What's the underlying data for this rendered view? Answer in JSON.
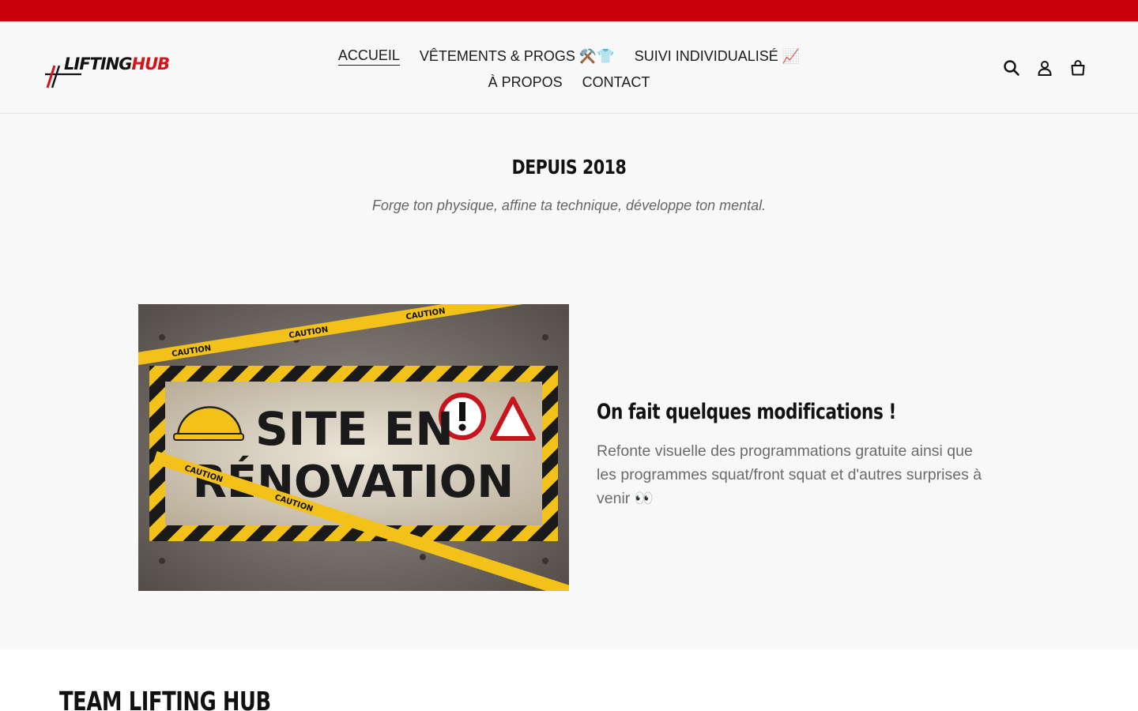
{
  "brand": {
    "logo_part1": "LIFTING",
    "logo_part2": "HUB",
    "accent_color": "#c8000b"
  },
  "nav": {
    "row1": [
      {
        "label": "ACCUEIL",
        "active": true
      },
      {
        "label": "VÊTEMENTS & PROGS ⚒️👕",
        "active": false
      },
      {
        "label": "SUIVI INDIVIDUALISÉ 📈",
        "active": false
      }
    ],
    "row2": [
      {
        "label": "À PROPOS",
        "active": false
      },
      {
        "label": "CONTACT",
        "active": false
      }
    ]
  },
  "header_icons": [
    "search-icon",
    "account-icon",
    "cart-icon"
  ],
  "hero": {
    "title": "DEPUIS 2018",
    "subtitle": "Forge ton physique, affine ta technique, développe ton mental."
  },
  "feature": {
    "image_text_line1": "SITE EN",
    "image_text_line2": "RÉNOVATION",
    "tape_label": "CAUTION",
    "heading": "On fait quelques modifications !",
    "text": "Refonte visuelle des programmations gratuite ainsi que les programmes squat/front squat et d'autres surprises à venir 👀"
  },
  "team": {
    "title": "TEAM LIFTING HUB"
  }
}
